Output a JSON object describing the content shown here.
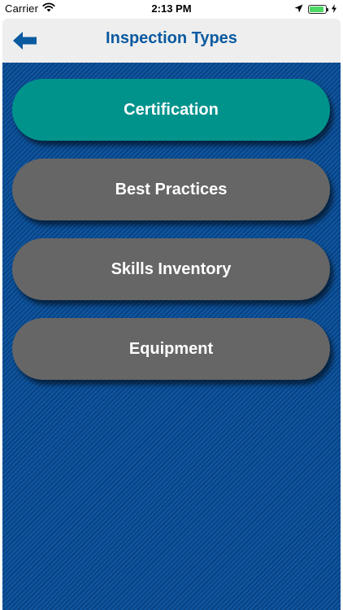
{
  "status_bar": {
    "carrier": "Carrier",
    "time": "2:13 PM",
    "battery_level": 0.9,
    "icons": [
      "wifi-icon",
      "location-arrow-icon",
      "battery-icon",
      "charging-bolt-icon"
    ]
  },
  "nav": {
    "title": "Inspection Types",
    "back_icon": "back-arrow-icon"
  },
  "colors": {
    "title": "#0a5aa0",
    "content_background": "#0e4f98",
    "active_button": "#00938c",
    "inactive_button": "#666666"
  },
  "menu": {
    "items": [
      {
        "label": "Certification",
        "state": "active"
      },
      {
        "label": "Best Practices",
        "state": "inactive"
      },
      {
        "label": "Skills Inventory",
        "state": "inactive"
      },
      {
        "label": "Equipment",
        "state": "inactive"
      }
    ]
  }
}
